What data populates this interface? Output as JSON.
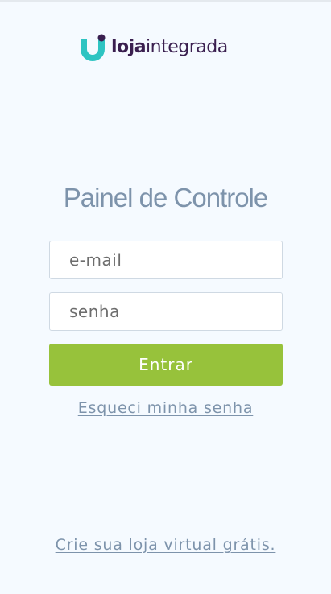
{
  "brand": {
    "logo_icon": "u-letter-logo-icon",
    "logo_primary": "loja",
    "logo_secondary": "integrada",
    "colors": {
      "logo_teal": "#2ec4c2",
      "logo_purple": "#3a1f4f",
      "accent_green": "#97c23b",
      "title_gray": "#7d93ab",
      "background": "#f5faff"
    }
  },
  "login": {
    "title": "Painel de Controle",
    "email_placeholder": "e-mail",
    "password_placeholder": "senha",
    "submit_label": "Entrar",
    "forgot_link": "Esqueci minha senha"
  },
  "footer": {
    "signup_link": "Crie sua loja virtual grátis."
  }
}
